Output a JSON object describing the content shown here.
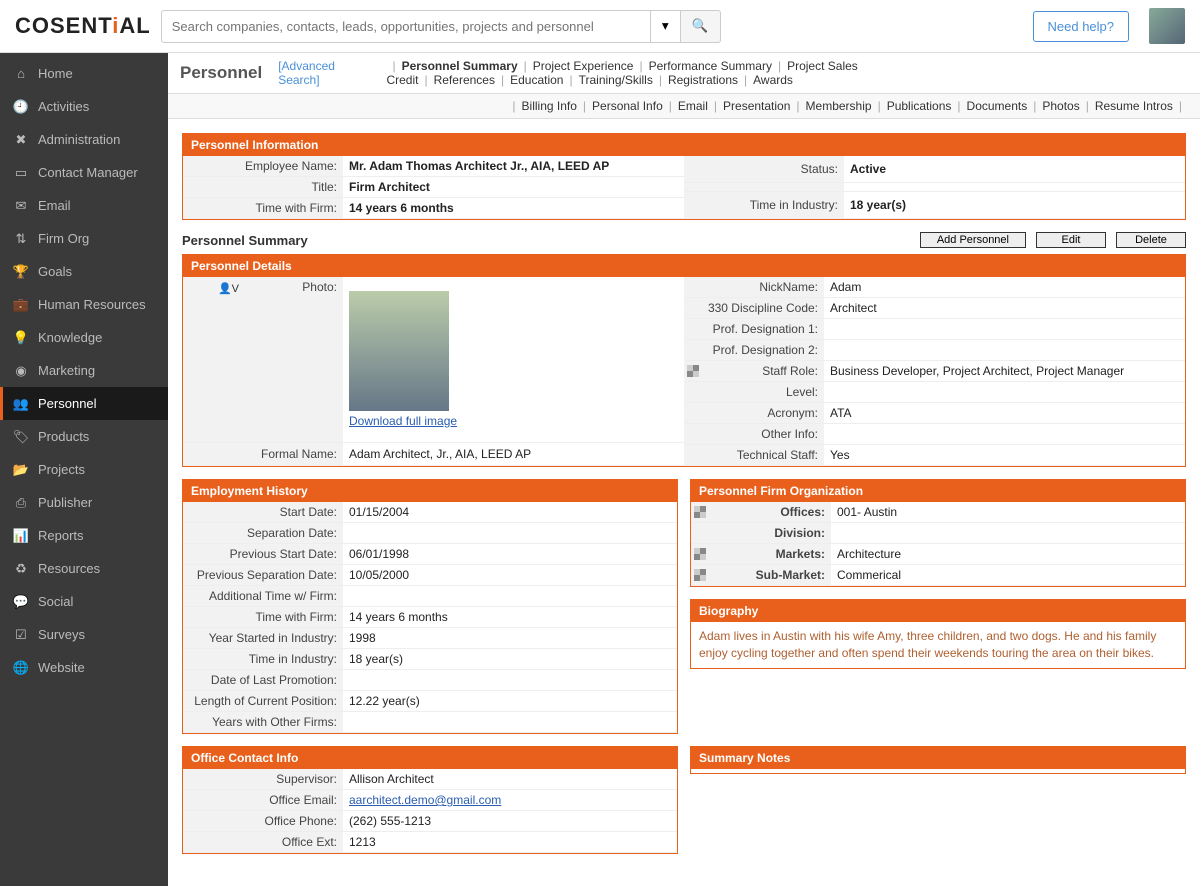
{
  "brand": "COSENTIAL",
  "search": {
    "placeholder": "Search companies, contacts, leads, opportunities, projects and personnel"
  },
  "needHelp": "Need help?",
  "sidebar": {
    "items": [
      {
        "icon": "⌂",
        "label": "Home"
      },
      {
        "icon": "🕘",
        "label": "Activities"
      },
      {
        "icon": "✖",
        "label": "Administration"
      },
      {
        "icon": "▭",
        "label": "Contact Manager"
      },
      {
        "icon": "✉",
        "label": "Email"
      },
      {
        "icon": "⇅",
        "label": "Firm Org"
      },
      {
        "icon": "🏆",
        "label": "Goals"
      },
      {
        "icon": "💼",
        "label": "Human Resources"
      },
      {
        "icon": "💡",
        "label": "Knowledge"
      },
      {
        "icon": "◉",
        "label": "Marketing"
      },
      {
        "icon": "👥",
        "label": "Personnel"
      },
      {
        "icon": "🏷",
        "label": "Products"
      },
      {
        "icon": "📂",
        "label": "Projects"
      },
      {
        "icon": "⎙",
        "label": "Publisher"
      },
      {
        "icon": "📊",
        "label": "Reports"
      },
      {
        "icon": "♻",
        "label": "Resources"
      },
      {
        "icon": "💬",
        "label": "Social"
      },
      {
        "icon": "☑",
        "label": "Surveys"
      },
      {
        "icon": "🌐",
        "label": "Website"
      }
    ],
    "activeIndex": 10
  },
  "crumb": {
    "title": "Personnel",
    "advanced": "[Advanced Search]"
  },
  "tabs1": [
    "Personnel Summary",
    "Project Experience",
    "Performance Summary",
    "Project Sales Credit",
    "References",
    "Education",
    "Training/Skills",
    "Registrations",
    "Awards"
  ],
  "tabs1Active": 0,
  "tabs2": [
    "Billing Info",
    "Personal Info",
    "Email",
    "Presentation",
    "Membership",
    "Publications",
    "Documents",
    "Photos",
    "Resume Intros"
  ],
  "pinfo": {
    "heading": "Personnel Information",
    "employeeNameLabel": "Employee Name:",
    "employeeName": "Mr. Adam Thomas Architect Jr., AIA, LEED AP",
    "titleLabel": "Title:",
    "title": "Firm Architect",
    "timeFirmLabel": "Time with Firm:",
    "timeFirm": "14 years 6 months",
    "statusLabel": "Status:",
    "status": "Active",
    "timeIndLabel": "Time in Industry:",
    "timeInd": "18 year(s)"
  },
  "subhead": {
    "title": "Personnel Summary",
    "addBtn": "Add Personnel",
    "editBtn": "Edit",
    "deleteBtn": "Delete"
  },
  "details": {
    "heading": "Personnel Details",
    "vcard": "V",
    "photoLabel": "Photo:",
    "downloadLink": "Download full image",
    "formalNameLabel": "Formal Name:",
    "formalName": "Adam Architect, Jr., AIA, LEED AP",
    "nicknameLabel": "NickName:",
    "nickname": "Adam",
    "discLabel": "330 Discipline Code:",
    "disc": "Architect",
    "pd1Label": "Prof. Designation 1:",
    "pd2Label": "Prof. Designation 2:",
    "staffRoleLabel": "Staff Role:",
    "staffRole": "Business Developer, Project Architect, Project Manager",
    "levelLabel": "Level:",
    "acronymLabel": "Acronym:",
    "acronym": "ATA",
    "otherLabel": "Other Info:",
    "techLabel": "Technical Staff:",
    "tech": "Yes"
  },
  "emp": {
    "heading": "Employment History",
    "rows": [
      {
        "k": "Start Date:",
        "v": "01/15/2004"
      },
      {
        "k": "Separation Date:",
        "v": ""
      },
      {
        "k": "Previous Start Date:",
        "v": "06/01/1998"
      },
      {
        "k": "Previous Separation Date:",
        "v": "10/05/2000"
      },
      {
        "k": "Additional Time w/ Firm:",
        "v": ""
      },
      {
        "k": "Time with Firm:",
        "v": "14 years 6 months"
      },
      {
        "k": "Year Started in Industry:",
        "v": "1998"
      },
      {
        "k": "Time in Industry:",
        "v": "18 year(s)"
      },
      {
        "k": "Date of Last Promotion:",
        "v": ""
      },
      {
        "k": "Length of Current Position:",
        "v": "12.22 year(s)"
      },
      {
        "k": "Years with Other Firms:",
        "v": ""
      }
    ]
  },
  "org": {
    "heading": "Personnel Firm Organization",
    "rows": [
      {
        "k": "Offices:",
        "v": "001- Austin",
        "icon": true
      },
      {
        "k": "Division:",
        "v": "",
        "icon": false
      },
      {
        "k": "Markets:",
        "v": "Architecture",
        "icon": true
      },
      {
        "k": "Sub-Market:",
        "v": "Commerical",
        "icon": true
      }
    ]
  },
  "bio": {
    "heading": "Biography",
    "text": "Adam lives in Austin with his wife Amy, three children, and two dogs. He and his family enjoy cycling together and often spend their weekends touring the area on their bikes."
  },
  "office": {
    "heading": "Office Contact Info",
    "rows": [
      {
        "k": "Supervisor:",
        "v": "Allison Architect",
        "link": false
      },
      {
        "k": "Office Email:",
        "v": "aarchitect.demo@gmail.com",
        "link": true
      },
      {
        "k": "Office Phone:",
        "v": "(262) 555-1213",
        "link": false
      },
      {
        "k": "Office Ext:",
        "v": "1213",
        "link": false
      }
    ]
  },
  "notes": {
    "heading": "Summary Notes"
  }
}
